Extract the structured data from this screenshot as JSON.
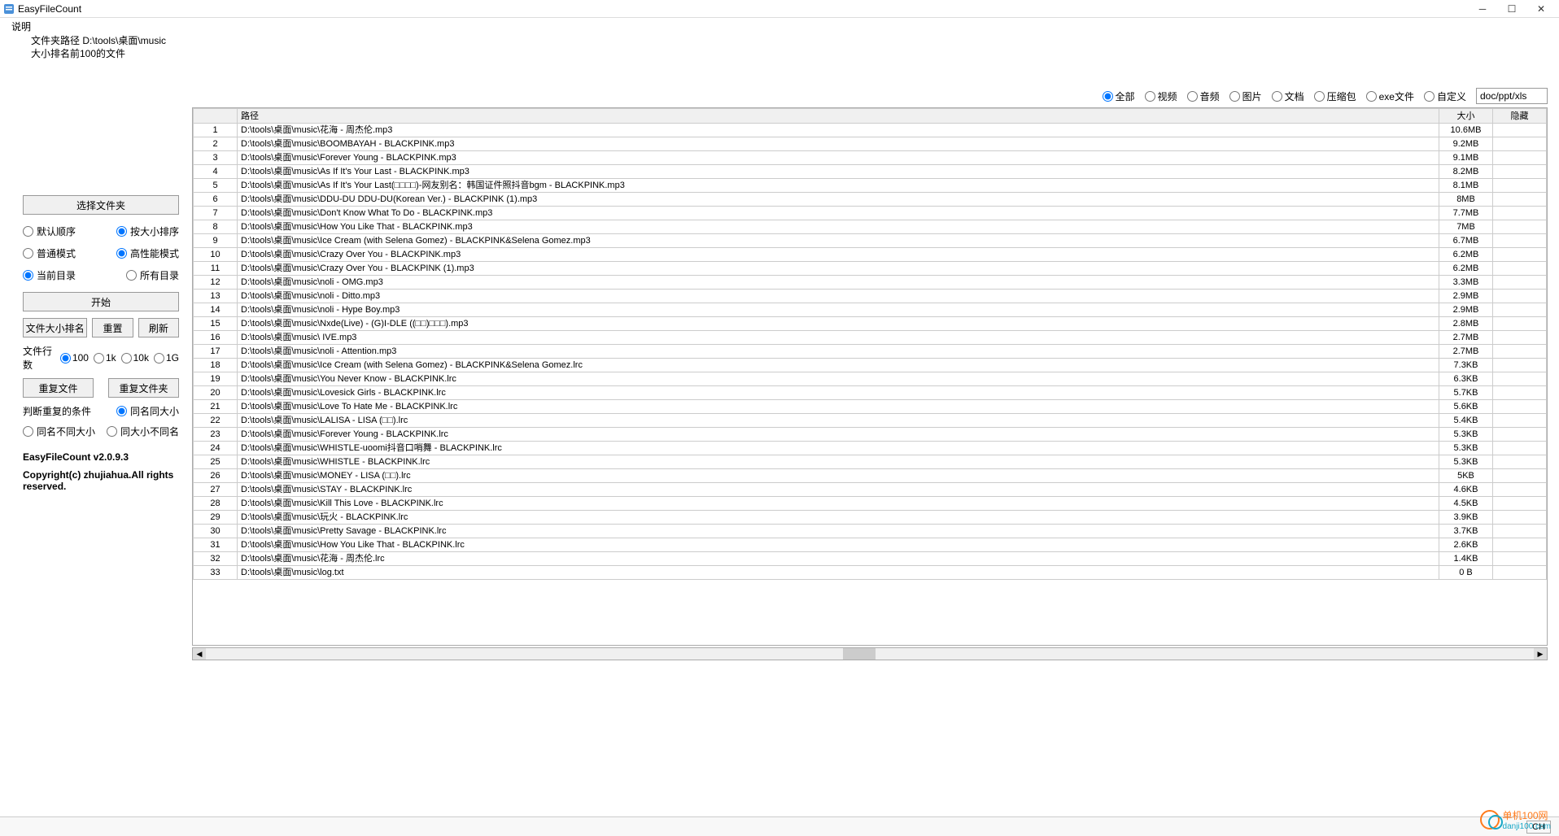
{
  "window": {
    "title": "EasyFileCount",
    "menu_help": "说明"
  },
  "info": {
    "folder_path": "文件夹路径 D:\\tools\\桌面\\music",
    "rank_label": "大小排名前100的文件"
  },
  "filters": {
    "all": "全部",
    "video": "视频",
    "audio": "音频",
    "image": "图片",
    "document": "文档",
    "archive": "压缩包",
    "exe": "exe文件",
    "custom": "自定义",
    "custom_value": "doc/ppt/xls"
  },
  "left": {
    "choose_folder": "选择文件夹",
    "sort_default": "默认顺序",
    "sort_size": "按大小排序",
    "mode_normal": "普通模式",
    "mode_perf": "高性能模式",
    "dir_current": "当前目录",
    "dir_all": "所有目录",
    "start": "开始",
    "file_rank": "文件大小排名",
    "reset": "重置",
    "refresh": "刷新",
    "rows_label": "文件行数",
    "rows_100": "100",
    "rows_1k": "1k",
    "rows_10k": "10k",
    "rows_1g": "1G",
    "dup_files": "重复文件",
    "dup_folders": "重复文件夹",
    "dup_cond_label": "判断重复的条件",
    "cond_name_size": "同名同大小",
    "cond_name_diff_size": "同名不同大小",
    "cond_size_diff_name": "同大小不同名",
    "version": "EasyFileCount v2.0.9.3",
    "copyright": "Copyright(c) zhujiahua.All rights reserved."
  },
  "table": {
    "col_path": "路径",
    "col_size": "大小",
    "col_hidden": "隐藏",
    "rows": [
      {
        "n": 1,
        "path": "D:\\tools\\桌面\\music\\花海 - 周杰伦.mp3",
        "size": "10.6MB"
      },
      {
        "n": 2,
        "path": "D:\\tools\\桌面\\music\\BOOMBAYAH - BLACKPINK.mp3",
        "size": "9.2MB"
      },
      {
        "n": 3,
        "path": "D:\\tools\\桌面\\music\\Forever Young - BLACKPINK.mp3",
        "size": "9.1MB"
      },
      {
        "n": 4,
        "path": "D:\\tools\\桌面\\music\\As If It's Your Last - BLACKPINK.mp3",
        "size": "8.2MB"
      },
      {
        "n": 5,
        "path": "D:\\tools\\桌面\\music\\As If It's Your Last(□□□□)-网友别名：韩国证件照抖音bgm - BLACKPINK.mp3",
        "size": "8.1MB"
      },
      {
        "n": 6,
        "path": "D:\\tools\\桌面\\music\\DDU-DU DDU-DU(Korean Ver.) - BLACKPINK (1).mp3",
        "size": "8MB"
      },
      {
        "n": 7,
        "path": "D:\\tools\\桌面\\music\\Don't Know What To Do - BLACKPINK.mp3",
        "size": "7.7MB"
      },
      {
        "n": 8,
        "path": "D:\\tools\\桌面\\music\\How You Like That - BLACKPINK.mp3",
        "size": "7MB"
      },
      {
        "n": 9,
        "path": "D:\\tools\\桌面\\music\\Ice Cream (with Selena Gomez) - BLACKPINK&Selena Gomez.mp3",
        "size": "6.7MB"
      },
      {
        "n": 10,
        "path": "D:\\tools\\桌面\\music\\Crazy Over You - BLACKPINK.mp3",
        "size": "6.2MB"
      },
      {
        "n": 11,
        "path": "D:\\tools\\桌面\\music\\Crazy Over You - BLACKPINK (1).mp3",
        "size": "6.2MB"
      },
      {
        "n": 12,
        "path": "D:\\tools\\桌面\\music\\noli - OMG.mp3",
        "size": "3.3MB"
      },
      {
        "n": 13,
        "path": "D:\\tools\\桌面\\music\\noli - Ditto.mp3",
        "size": "2.9MB"
      },
      {
        "n": 14,
        "path": "D:\\tools\\桌面\\music\\noli - Hype Boy.mp3",
        "size": "2.9MB"
      },
      {
        "n": 15,
        "path": "D:\\tools\\桌面\\music\\Nxde(Live) - (G)I-DLE ((□□)□□□).mp3",
        "size": "2.8MB"
      },
      {
        "n": 16,
        "path": "D:\\tools\\桌面\\music\\ IVE.mp3",
        "size": "2.7MB"
      },
      {
        "n": 17,
        "path": "D:\\tools\\桌面\\music\\noli - Attention.mp3",
        "size": "2.7MB"
      },
      {
        "n": 18,
        "path": "D:\\tools\\桌面\\music\\Ice Cream (with Selena Gomez) - BLACKPINK&Selena Gomez.lrc",
        "size": "7.3KB"
      },
      {
        "n": 19,
        "path": "D:\\tools\\桌面\\music\\You Never Know - BLACKPINK.lrc",
        "size": "6.3KB"
      },
      {
        "n": 20,
        "path": "D:\\tools\\桌面\\music\\Lovesick Girls - BLACKPINK.lrc",
        "size": "5.7KB"
      },
      {
        "n": 21,
        "path": "D:\\tools\\桌面\\music\\Love To Hate Me - BLACKPINK.lrc",
        "size": "5.6KB"
      },
      {
        "n": 22,
        "path": "D:\\tools\\桌面\\music\\LALISA - LISA (□□).lrc",
        "size": "5.4KB"
      },
      {
        "n": 23,
        "path": "D:\\tools\\桌面\\music\\Forever Young - BLACKPINK.lrc",
        "size": "5.3KB"
      },
      {
        "n": 24,
        "path": "D:\\tools\\桌面\\music\\WHISTLE-uoomi抖音口哨舞 - BLACKPINK.lrc",
        "size": "5.3KB"
      },
      {
        "n": 25,
        "path": "D:\\tools\\桌面\\music\\WHISTLE - BLACKPINK.lrc",
        "size": "5.3KB"
      },
      {
        "n": 26,
        "path": "D:\\tools\\桌面\\music\\MONEY - LISA (□□).lrc",
        "size": "5KB"
      },
      {
        "n": 27,
        "path": "D:\\tools\\桌面\\music\\STAY - BLACKPINK.lrc",
        "size": "4.6KB"
      },
      {
        "n": 28,
        "path": "D:\\tools\\桌面\\music\\Kill This Love - BLACKPINK.lrc",
        "size": "4.5KB"
      },
      {
        "n": 29,
        "path": "D:\\tools\\桌面\\music\\玩火 - BLACKPINK.lrc",
        "size": "3.9KB"
      },
      {
        "n": 30,
        "path": "D:\\tools\\桌面\\music\\Pretty Savage - BLACKPINK.lrc",
        "size": "3.7KB"
      },
      {
        "n": 31,
        "path": "D:\\tools\\桌面\\music\\How You Like That - BLACKPINK.lrc",
        "size": "2.6KB"
      },
      {
        "n": 32,
        "path": "D:\\tools\\桌面\\music\\花海 - 周杰伦.lrc",
        "size": "1.4KB"
      },
      {
        "n": 33,
        "path": "D:\\tools\\桌面\\music\\log.txt",
        "size": "0 B"
      }
    ]
  },
  "status": {
    "ime": "CH"
  },
  "watermark": {
    "text": "单机100网",
    "url": "danji100.com"
  }
}
